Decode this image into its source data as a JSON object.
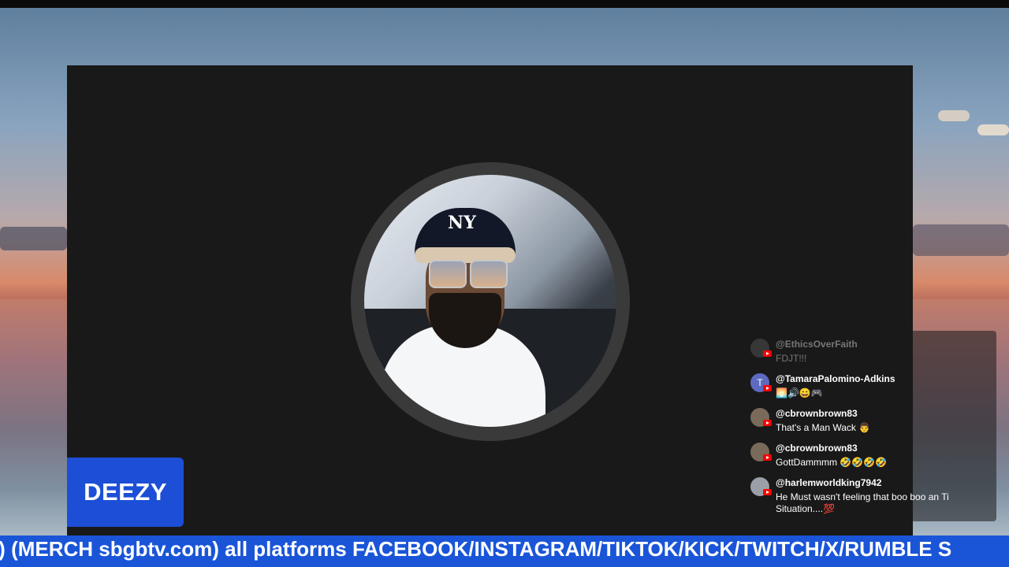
{
  "speaker": {
    "name": "DEEZY",
    "cap_logo": "NY"
  },
  "chat": {
    "messages": [
      {
        "user": "@EthicsOverFaith",
        "text": "FDJT!!!",
        "avatar": "photo"
      },
      {
        "user": "@TamaraPalomino-Adkins",
        "text": "🌅🔊😄🎮",
        "avatar": "T",
        "avatar_color": "#5c6bc0"
      },
      {
        "user": "@cbrownbrown83",
        "text": "That's a Man Wack 👨",
        "avatar": "photo"
      },
      {
        "user": "@cbrownbrown83",
        "text": "GottDammmm 🤣🤣🤣🤣",
        "avatar": "photo"
      },
      {
        "user": "@harlemworldking7942",
        "text": "He Must wasn't feeling that boo boo an Ti Situation....💯",
        "avatar": "photo"
      }
    ]
  },
  "ticker": {
    "text": "') (MERCH sbgbtv.com) all platforms FACEBOOK/INSTAGRAM/TIKTOK/KICK/TWITCH/X/RUMBLE S"
  },
  "colors": {
    "nameplate": "#1c4fd6",
    "ticker": "#1a55d8",
    "stage": "#191919"
  }
}
